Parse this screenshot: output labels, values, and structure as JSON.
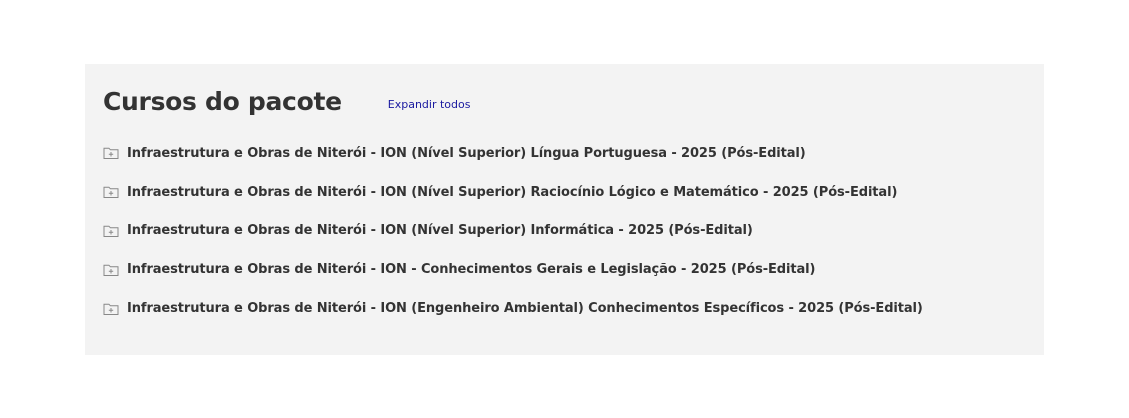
{
  "section": {
    "title": "Cursos do pacote",
    "expand_all_label": "Expandir todos"
  },
  "courses": [
    {
      "label": "Infraestrutura e Obras de Niterói - ION (Nível Superior) Língua Portuguesa - 2025 (Pós-Edital)",
      "icon": "folder-plus-icon"
    },
    {
      "label": "Infraestrutura e Obras de Niterói - ION (Nível Superior) Raciocínio Lógico e Matemático - 2025 (Pós-Edital)",
      "icon": "folder-plus-icon"
    },
    {
      "label": "Infraestrutura e Obras de Niterói - ION (Nível Superior) Informática - 2025 (Pós-Edital)",
      "icon": "folder-plus-icon"
    },
    {
      "label": "Infraestrutura e Obras de Niterói - ION - Conhecimentos Gerais e Legislação - 2025 (Pós-Edital)",
      "icon": "folder-plus-icon"
    },
    {
      "label": "Infraestrutura e Obras de Niterói - ION (Engenheiro Ambiental) Conhecimentos Específicos - 2025 (Pós-Edital)",
      "icon": "folder-plus-icon"
    }
  ],
  "colors": {
    "panel_background": "#f3f3f3",
    "text": "#333333",
    "link": "#1a1aa0"
  }
}
